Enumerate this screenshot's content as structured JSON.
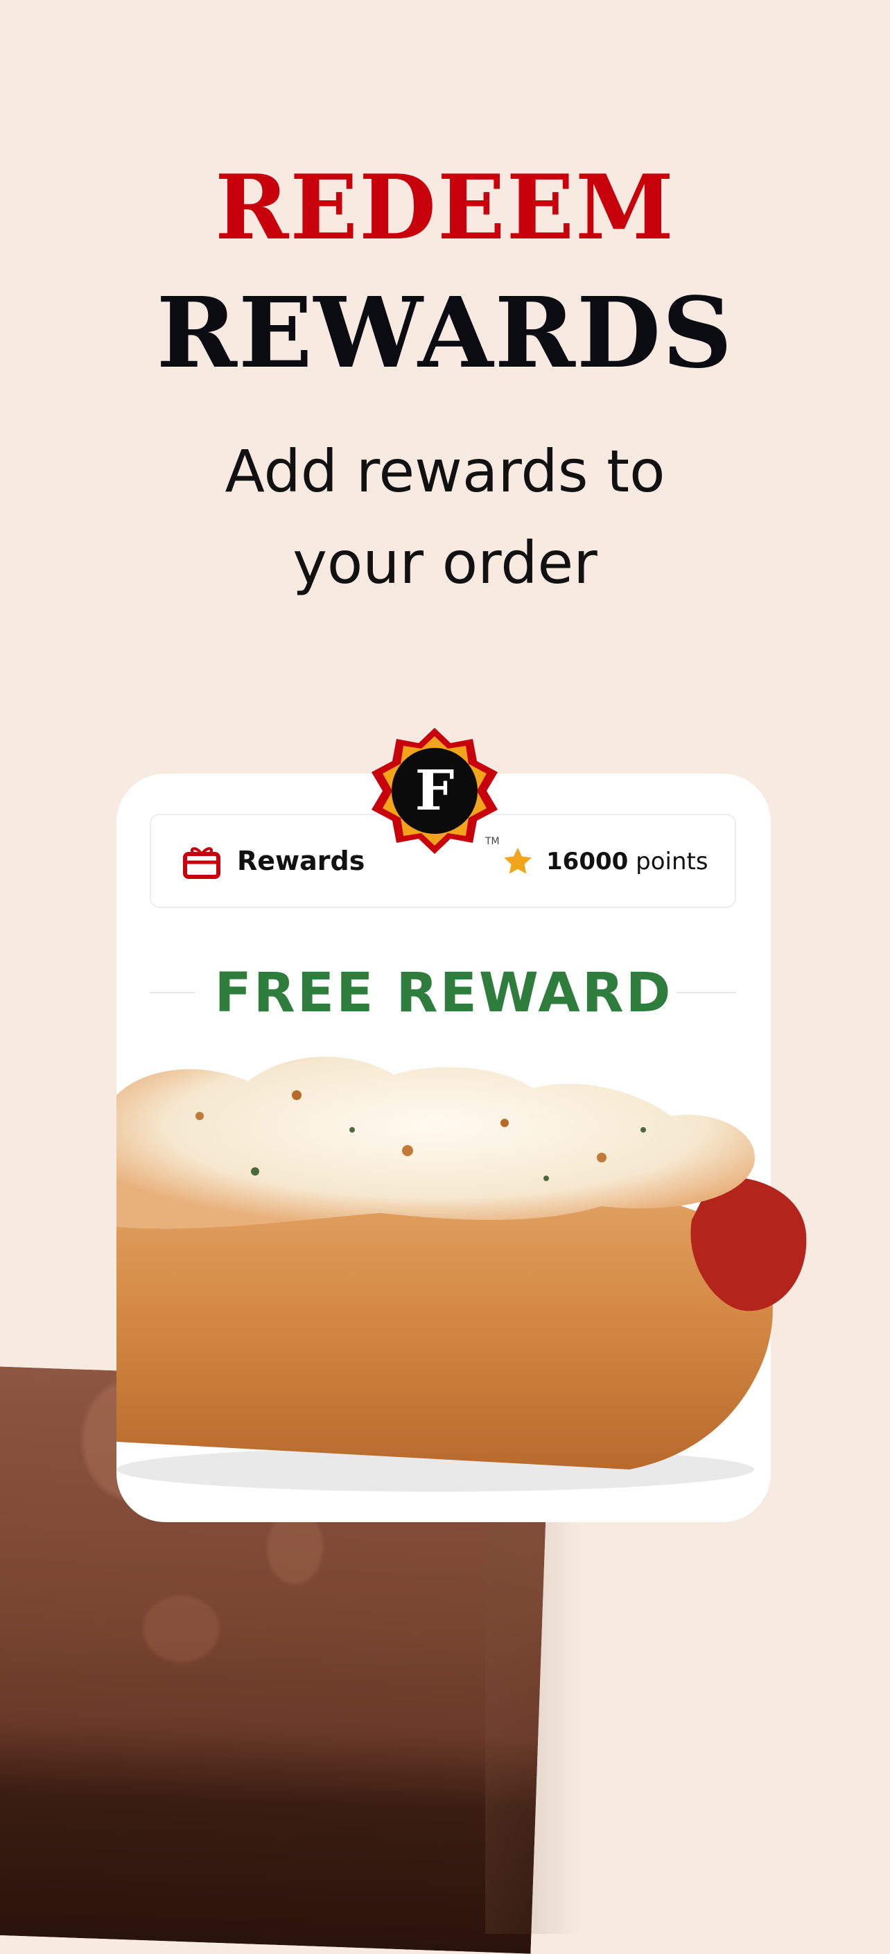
{
  "hero": {
    "headline_top": "REDEEM",
    "headline_bottom": "REWARDS",
    "subtitle_line1": "Add rewards to",
    "subtitle_line2": "your order"
  },
  "card": {
    "badge_letter": "F",
    "badge_tm": "TM",
    "rewards_label": "Rewards",
    "points_value": "16000",
    "points_unit": "points",
    "free_reward": "FREE REWARD"
  },
  "colors": {
    "background": "#f7ebe1",
    "accent_red": "#c8000b",
    "reward_green": "#2e7d3c",
    "star_gold": "#f2a51a"
  },
  "icons": [
    "gift-icon",
    "star-icon",
    "firehouse-badge-icon"
  ]
}
